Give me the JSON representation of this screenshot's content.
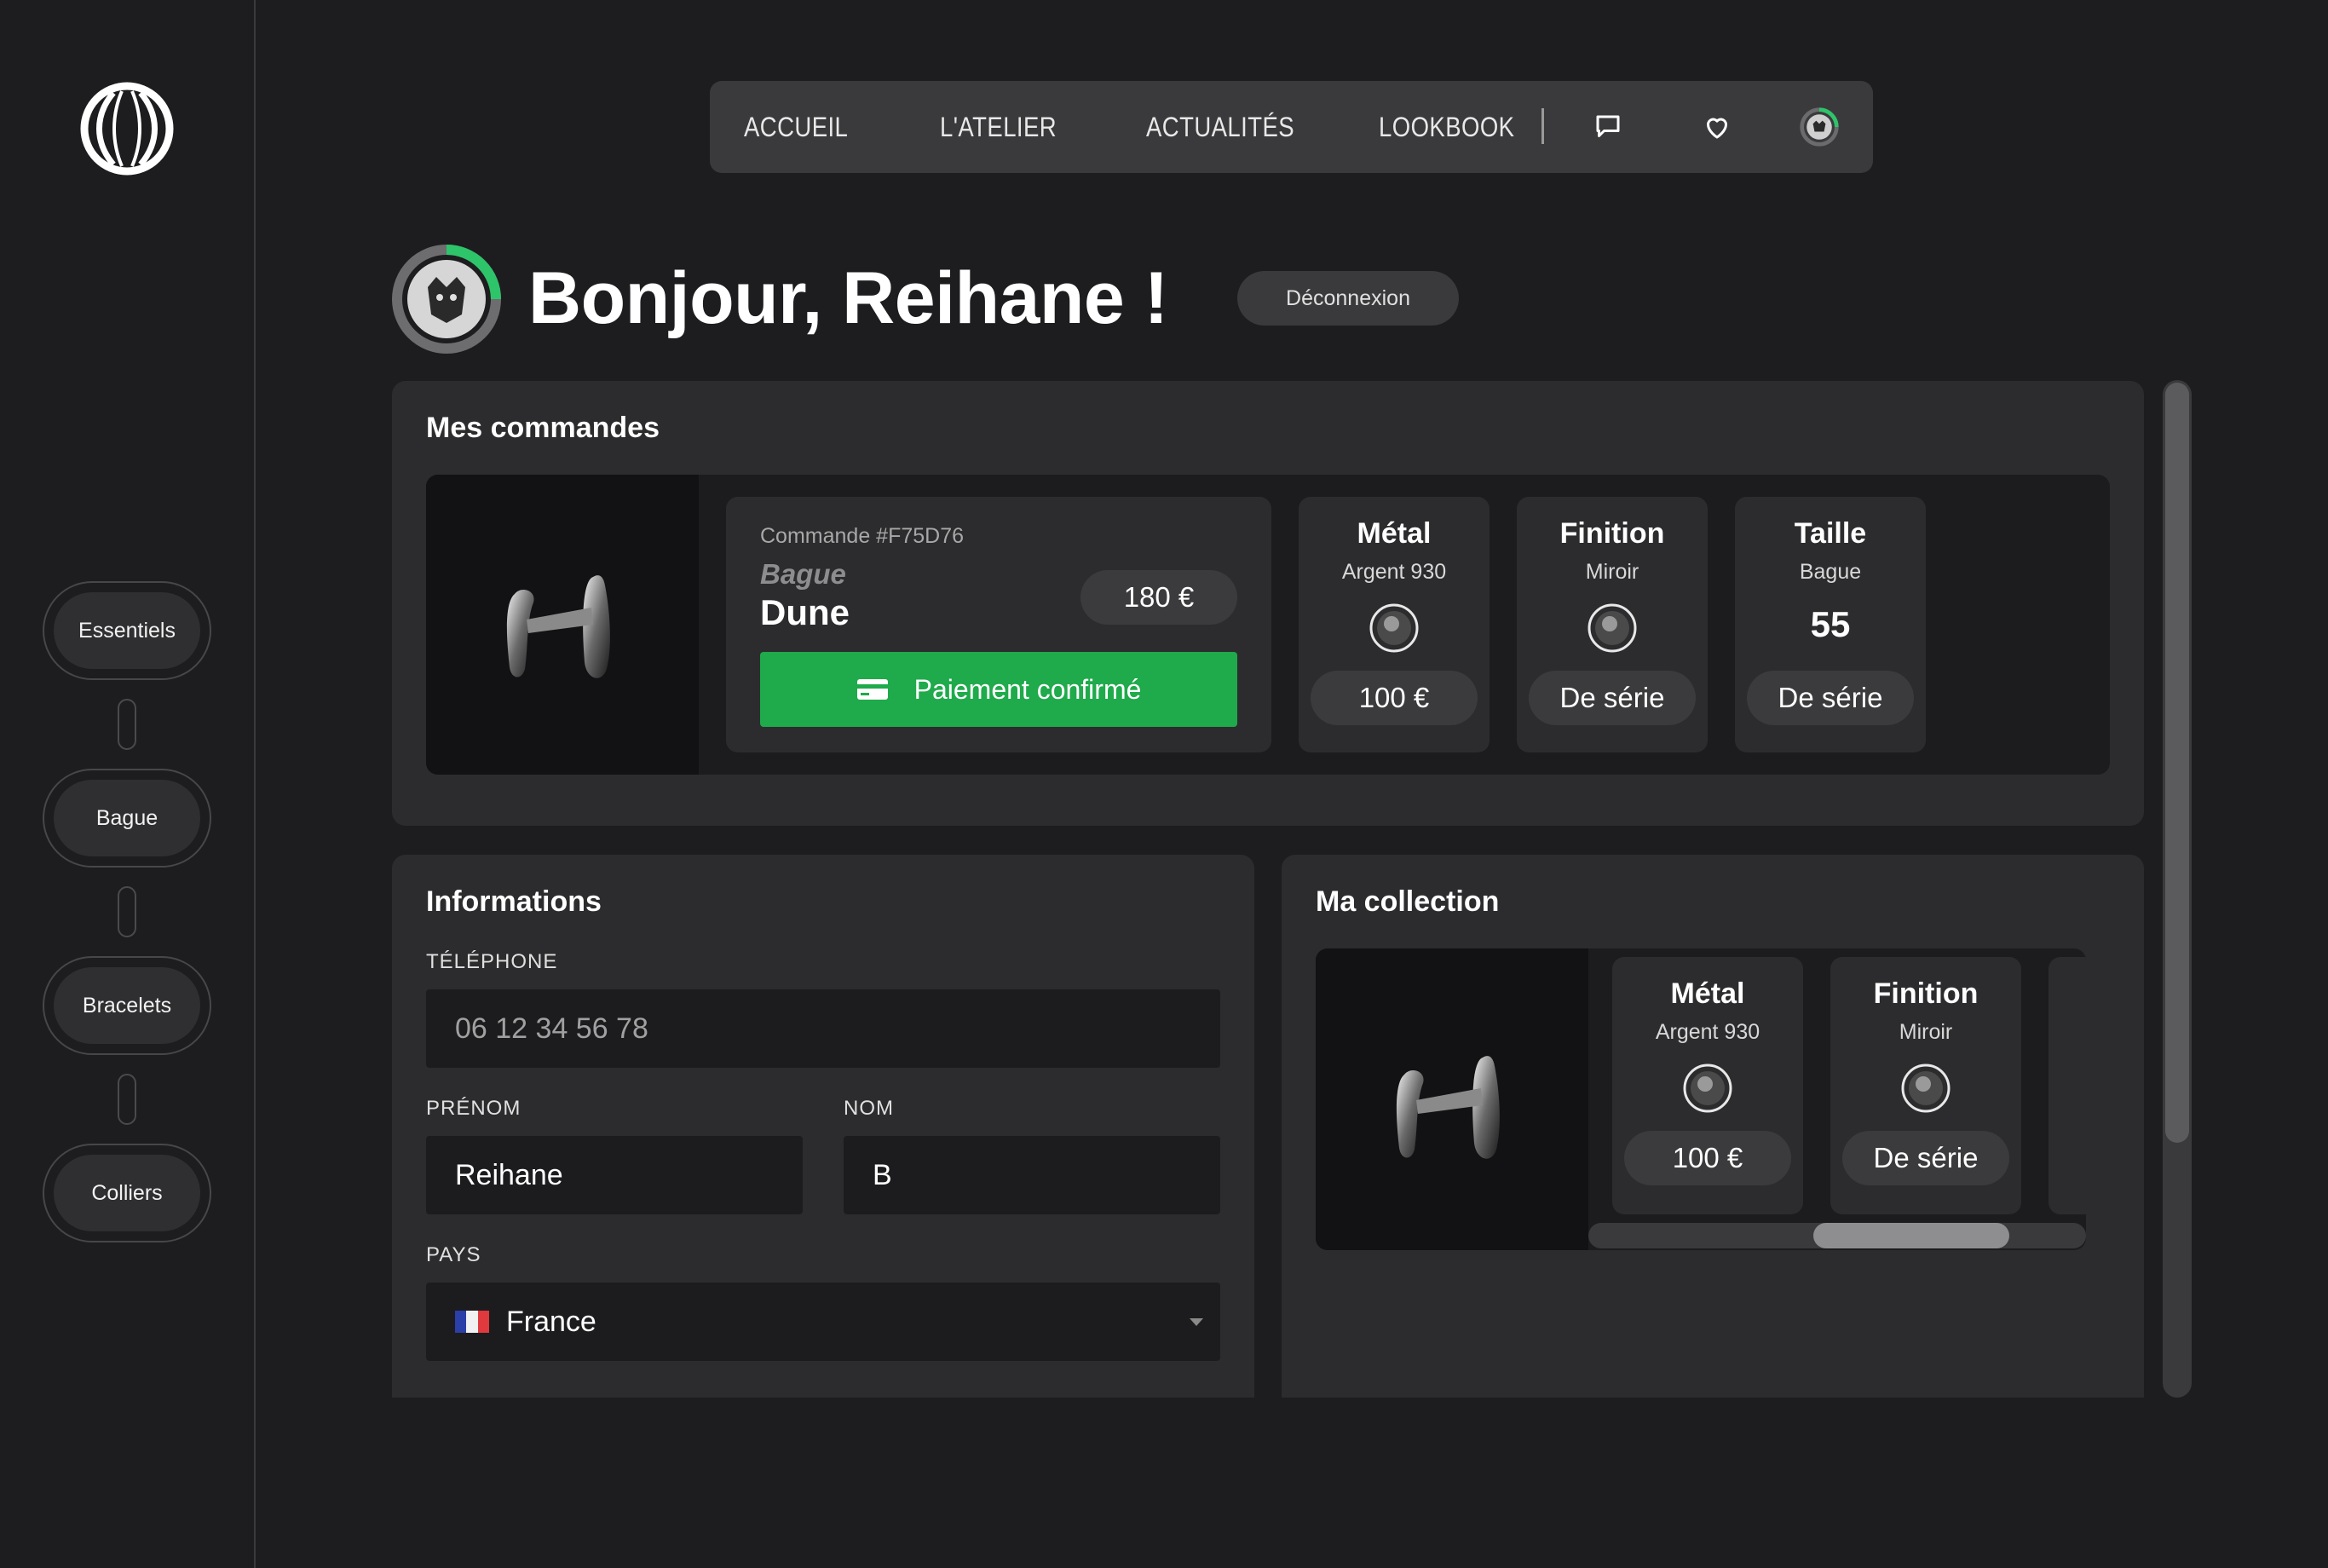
{
  "sidebar": {
    "items": [
      {
        "label": "Essentiels"
      },
      {
        "label": "Bague"
      },
      {
        "label": "Bracelets"
      },
      {
        "label": "Colliers"
      }
    ]
  },
  "topnav": {
    "links": [
      "ACCUEIL",
      "L'ATELIER",
      "ACTUALITÉS",
      "LOOKBOOK"
    ],
    "icons": [
      "chat-icon",
      "heart-icon",
      "avatar-icon"
    ]
  },
  "greeting": {
    "title": "Bonjour, Reihane !",
    "logout_label": "Déconnexion",
    "avatar_progress": 0.25
  },
  "orders": {
    "title": "Mes commandes",
    "order": {
      "number": "Commande #F75D76",
      "category": "Bague",
      "name": "Dune",
      "price": "180 €",
      "payment_status": "Paiement confirmé",
      "options": [
        {
          "title": "Métal",
          "subtitle": "Argent 930",
          "value": "",
          "pill": "100 €"
        },
        {
          "title": "Finition",
          "subtitle": "Miroir",
          "value": "",
          "pill": "De série"
        },
        {
          "title": "Taille",
          "subtitle": "Bague",
          "value": "55",
          "pill": "De série"
        }
      ]
    }
  },
  "info": {
    "title": "Informations",
    "phone_label": "TÉLÉPHONE",
    "phone_value": "06 12 34 56 78",
    "firstname_label": "PRÉNOM",
    "firstname_value": "Reihane",
    "lastname_label": "NOM",
    "lastname_value": "B",
    "country_label": "PAYS",
    "country_value": "France"
  },
  "collection": {
    "title": "Ma collection",
    "options": [
      {
        "title": "Métal",
        "subtitle": "Argent 930",
        "pill": "100 €"
      },
      {
        "title": "Finition",
        "subtitle": "Miroir",
        "pill": "De série"
      }
    ]
  },
  "colors": {
    "accent_green": "#1faa4b",
    "background": "#1d1d1f",
    "panel": "#2c2c2e"
  }
}
